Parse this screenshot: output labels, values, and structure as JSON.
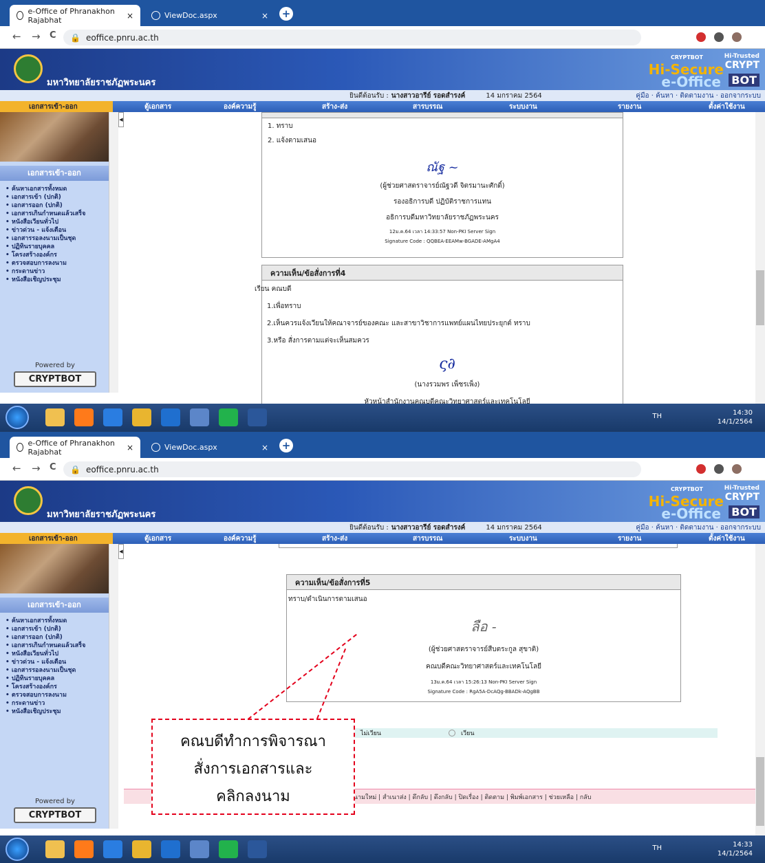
{
  "browser": {
    "tab1": "e-Office of Phranakhon Rajabhat",
    "tab2": "ViewDoc.aspx",
    "close": "×",
    "new_tab": "+",
    "url": "eoffice.pnru.ac.th",
    "back": "←",
    "forward": "→",
    "reload": "C"
  },
  "site": {
    "university_name": "มหาวิทยาลัยราชภัฏพระนคร",
    "brand_cryptbot": "CRYPTBOT",
    "brand_hisecure": "Hi-Secure",
    "brand_eoffice": "e-Office",
    "brand_hitrusted": "Hi-Trusted",
    "brand_crypt": "CRYPT",
    "brand_bot": "BOT",
    "welcome_prefix": "ยินดีต้อนรับ :",
    "welcome_user": "นางสาวอารีย์ รอดสำรงค์",
    "date": "14 มกราคม 2564",
    "top_links": [
      "คู่มือ",
      "ค้นหา",
      "ติดตามงาน",
      "ออกจากระบบ"
    ]
  },
  "menu": [
    "เอกสารเข้า-ออก",
    "ตู้เอกสาร",
    "องค์ความรู้",
    "สร้าง-ส่ง",
    "สารบรรณ",
    "ระบบงาน",
    "รายงาน",
    "ตั้งค่าใช้งาน"
  ],
  "sidebar": {
    "heading": "เอกสารเข้า-ออก",
    "items": [
      "ค้นหาเอกสารทั้งหมด",
      "เอกสารเข้า (ปกติ)",
      "เอกสารออก (ปกติ)",
      "เอกสารเกินกำหนดแล้วเสร็จ",
      "หนังสือเวียนทั่วไป",
      "ข่าวด่วน - แจ้งเตือน",
      "เอกสารรอลงนามเป็นชุด",
      "ปฏิทินรายบุคคล",
      "โครงสร้างองค์กร",
      "ตรวจสอบการลงนาม",
      "กระดานข่าว",
      "หนังสือเชิญประชุม"
    ],
    "powered_by": "Powered by",
    "powered_logo": "CRYPTBOT"
  },
  "screen1": {
    "prev_panel": {
      "lines": [
        "1. ทราบ",
        "2. แจ้งตามเสนอ"
      ],
      "signer": "(ผู้ช่วยศาสตราจารย์ณัฐวดี จิตรมานะศักดิ์)",
      "role1": "รองอธิการบดี ปฏิบัติราชการแทน",
      "role2": "อธิการบดีมหาวิทยาลัยราชภัฏพระนคร",
      "stamp": "12ม.ค.64 เวลา 14:33:57 Non-PKI Server Sign",
      "sigcode": "Signature Code : QQBEA-EEAMw-BGADE-AMgA4"
    },
    "panel4": {
      "title": "ความเห็น/ข้อสั่งการที่4",
      "greeting": "เรียน คณบดี",
      "lines": [
        "1.เพื่อทราบ",
        "2.เห็นควรแจ้งเวียนให้คณาจารย์ของคณะ และสาขาวิชาการแพทย์แผนไทยประยุกต์ ทราบ",
        "3.หรือ สั่งการตามแต่จะเห็นสมควร"
      ],
      "signer": "(นางรวมพร เพ็ชรเพ็ง)",
      "role": "หัวหน้าสำนักงานคณบดีคณะวิทยาศาสตร์และเทคโนโลยี"
    },
    "clock_time": "14:30",
    "clock_date": "14/1/2564"
  },
  "screen2": {
    "panel5": {
      "title": "ความเห็น/ข้อสั่งการที่5",
      "text": "ทราบ/ดำเนินการตามเสนอ",
      "signer": "(ผู้ช่วยศาสตราจารย์สืบตระกูล สุขาติ)",
      "role": "คณบดีคณะวิทยาศาสตร์และเทคโนโลยี",
      "stamp": "13ม.ค.64 เวลา 15:26:13 Non-PKI Server Sign",
      "sigcode": "Signature Code : RgA5A-DcAQg-BBADk-AQgBB"
    },
    "radio_no": "ไม่เวียน",
    "radio_yes": "เวียน",
    "bottom_actions": "ลงนามใหม่ | สำเนาส่ง | ดึกลับ | ดึงกลับ | ปิดเรื่อง | ติดตาม | พิมพ์เอกสาร | ช่วยเหลือ | กลับ",
    "clock_time": "14:33",
    "clock_date": "14/1/2564"
  },
  "annotation": {
    "line1": "คณบดีทำการพิจารณา",
    "line2": "สั่งการเอกสารและ",
    "line3": "คลิกลงนาม"
  },
  "taskbar_lang": "TH",
  "colors": {
    "menu_blue": "#2d5fb7",
    "menu_gold": "#f3b32c",
    "anno_red": "#e3001b"
  }
}
